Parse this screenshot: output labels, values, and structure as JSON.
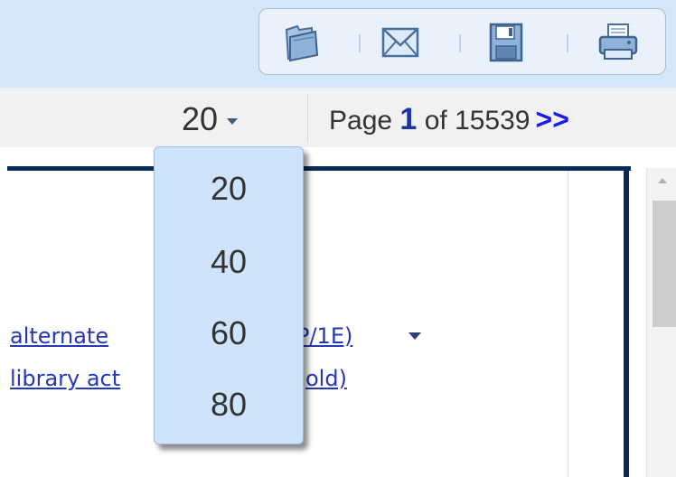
{
  "toolbar": {
    "icons": [
      "folder-icon",
      "email-icon",
      "save-icon",
      "print-icon"
    ]
  },
  "pager": {
    "per_page_value": "20",
    "page_word": "Page",
    "current_page": "1",
    "of_word": "of",
    "total_pages": "15539",
    "next_label": ">>"
  },
  "results": {
    "link1_start": "alternate",
    "link1_end": "P/1E)",
    "link2_start": "library act",
    "link2_end": "old)"
  },
  "dropdown": {
    "options": [
      "20",
      "40",
      "60",
      "80"
    ]
  },
  "colors": {
    "header_band": "#d4e6f9",
    "panel_border": "#0b2a57",
    "link": "#2438b8",
    "dropdown_bg": "#cfe3fb"
  }
}
